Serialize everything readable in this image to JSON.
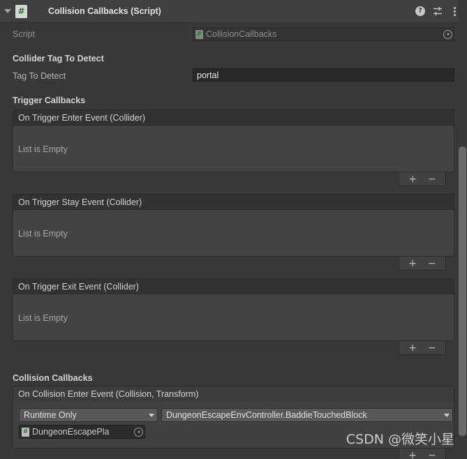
{
  "component": {
    "title": "Collision Callbacks (Script)",
    "foldout_expanded": true,
    "icon": "csharp-script-icon",
    "header_icons": {
      "help": "?",
      "preset": "preset-slider-icon",
      "menu": "kebab-menu-icon"
    }
  },
  "script_row": {
    "label": "Script",
    "value": "CollisionCallbacks",
    "disabled": true
  },
  "collider_tag_section": {
    "title": "Collider Tag To Detect",
    "tag_row": {
      "label": "Tag To Detect",
      "value": "portal",
      "placeholder": ""
    }
  },
  "trigger_callbacks": {
    "title": "Trigger Callbacks",
    "lists": [
      {
        "header": "On Trigger Enter Event (Collider)",
        "empty_text": "List is Empty",
        "add_label": "+",
        "remove_label": "−"
      },
      {
        "header": "On Trigger Stay Event (Collider)",
        "empty_text": "List is Empty",
        "add_label": "+",
        "remove_label": "−"
      },
      {
        "header": "On Trigger Exit Event (Collider)",
        "empty_text": "List is Empty",
        "add_label": "+",
        "remove_label": "−"
      }
    ]
  },
  "collision_callbacks": {
    "title": "Collision Callbacks",
    "event": {
      "header": "On Collision Enter Event (Collision, Transform)",
      "entry": {
        "mode": "Runtime Only",
        "function": "DungeonEscapeEnvController.BaddieTouchedBlock",
        "target_object": "DungeonEscapePla"
      },
      "add_label": "+",
      "remove_label": "−"
    }
  },
  "watermark": "CSDN @微笑小星",
  "colors": {
    "background": "#383838",
    "header_bar": "#3f3f3f",
    "list_body": "#434343",
    "list_header": "#323232",
    "input_bg": "#282828",
    "dropdown_bg": "#585858",
    "scrollbar_thumb": "#6b6b6b",
    "script_green": "#2f7d32"
  }
}
